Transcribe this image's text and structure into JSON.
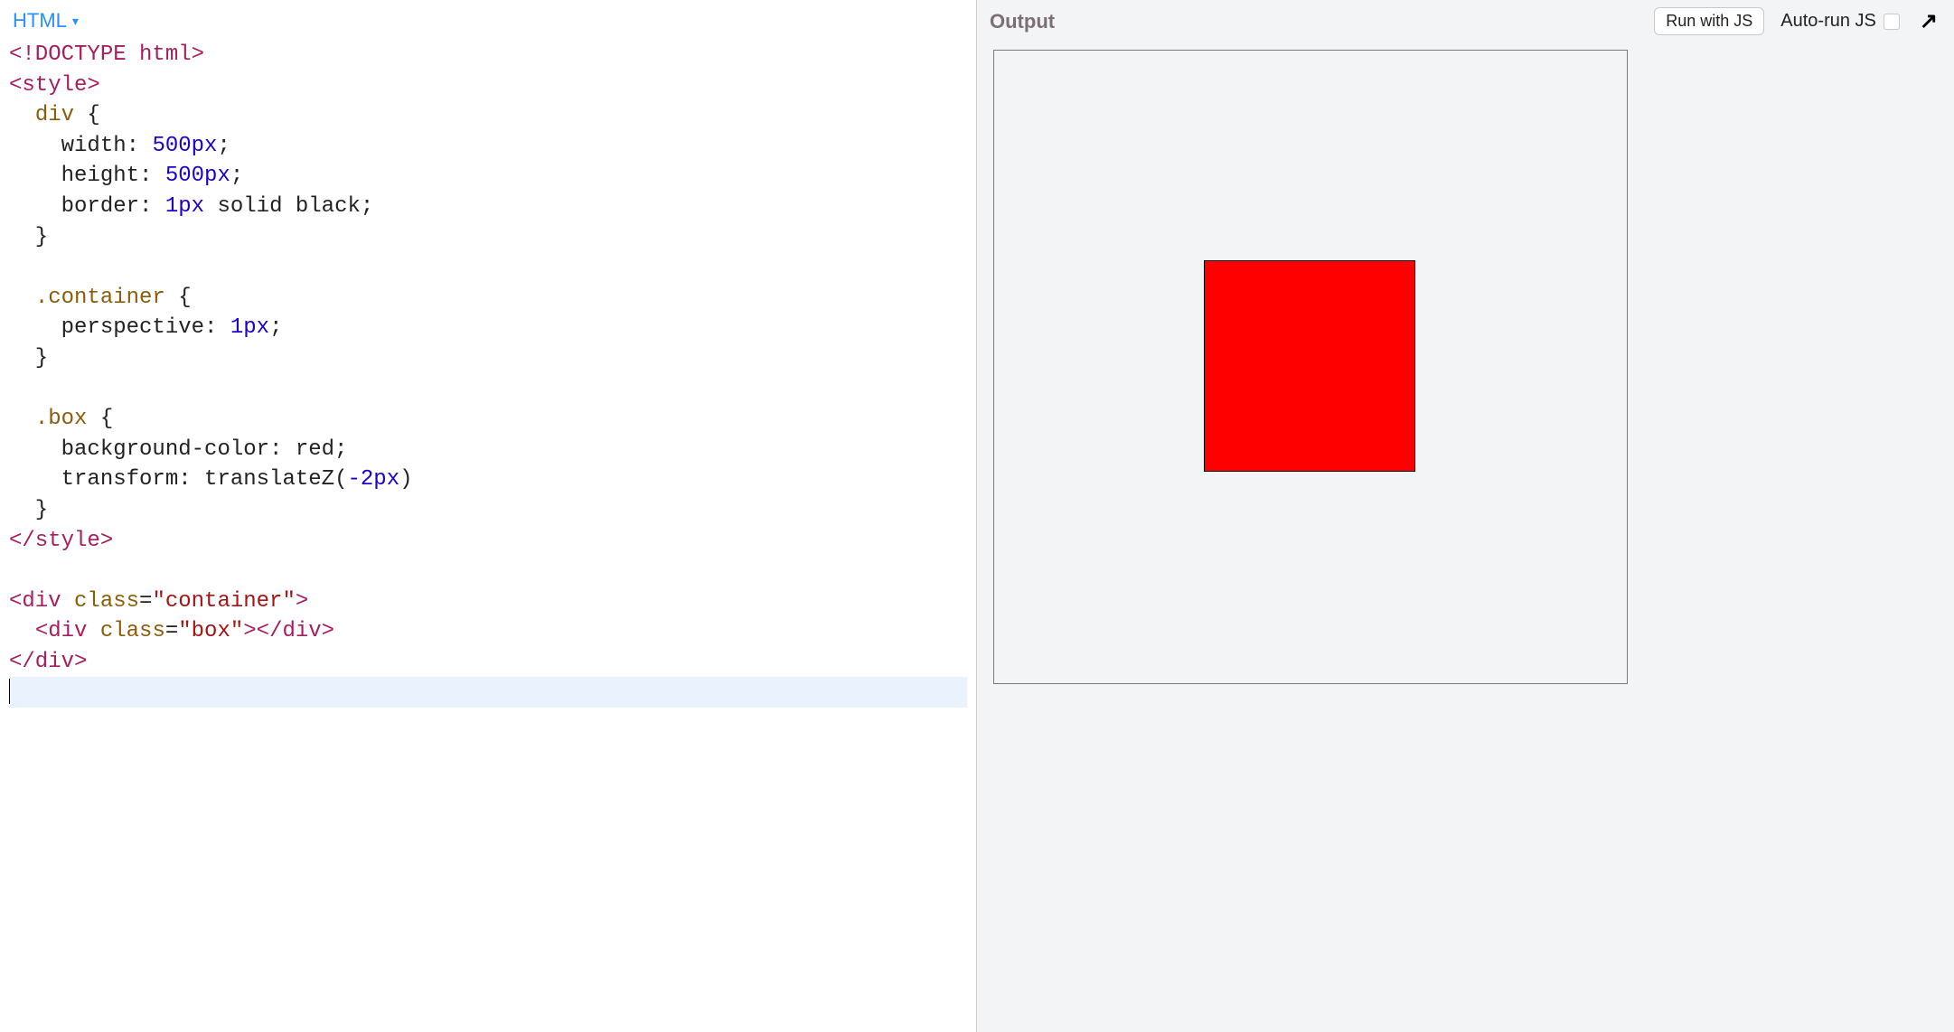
{
  "left": {
    "language_label": "HTML",
    "code_lines": [
      {
        "idx": 0,
        "segs": [
          {
            "c": "k",
            "t": "<!DOCTYPE html>"
          }
        ]
      },
      {
        "idx": 1,
        "segs": [
          {
            "c": "t",
            "t": "<style>"
          }
        ]
      },
      {
        "idx": 2,
        "segs": [
          {
            "c": "pun",
            "t": "  "
          },
          {
            "c": "sel",
            "t": "div"
          },
          {
            "c": "pun",
            "t": " {"
          }
        ]
      },
      {
        "idx": 3,
        "segs": [
          {
            "c": "pun",
            "t": "    "
          },
          {
            "c": "prop",
            "t": "width"
          },
          {
            "c": "pun",
            "t": ": "
          },
          {
            "c": "num",
            "t": "500px"
          },
          {
            "c": "pun",
            "t": ";"
          }
        ]
      },
      {
        "idx": 4,
        "segs": [
          {
            "c": "pun",
            "t": "    "
          },
          {
            "c": "prop",
            "t": "height"
          },
          {
            "c": "pun",
            "t": ": "
          },
          {
            "c": "num",
            "t": "500px"
          },
          {
            "c": "pun",
            "t": ";"
          }
        ]
      },
      {
        "idx": 5,
        "segs": [
          {
            "c": "pun",
            "t": "    "
          },
          {
            "c": "prop",
            "t": "border"
          },
          {
            "c": "pun",
            "t": ": "
          },
          {
            "c": "num",
            "t": "1px"
          },
          {
            "c": "pun",
            "t": " solid black;"
          }
        ]
      },
      {
        "idx": 6,
        "segs": [
          {
            "c": "pun",
            "t": "  }"
          }
        ]
      },
      {
        "idx": 7,
        "segs": [
          {
            "c": "pun",
            "t": ""
          }
        ]
      },
      {
        "idx": 8,
        "segs": [
          {
            "c": "pun",
            "t": "  "
          },
          {
            "c": "sel",
            "t": ".container"
          },
          {
            "c": "pun",
            "t": " {"
          }
        ]
      },
      {
        "idx": 9,
        "segs": [
          {
            "c": "pun",
            "t": "    "
          },
          {
            "c": "prop",
            "t": "perspective"
          },
          {
            "c": "pun",
            "t": ": "
          },
          {
            "c": "num",
            "t": "1px"
          },
          {
            "c": "pun",
            "t": ";"
          }
        ]
      },
      {
        "idx": 10,
        "segs": [
          {
            "c": "pun",
            "t": "  }"
          }
        ]
      },
      {
        "idx": 11,
        "segs": [
          {
            "c": "pun",
            "t": ""
          }
        ]
      },
      {
        "idx": 12,
        "segs": [
          {
            "c": "pun",
            "t": "  "
          },
          {
            "c": "sel",
            "t": ".box"
          },
          {
            "c": "pun",
            "t": " {"
          }
        ]
      },
      {
        "idx": 13,
        "segs": [
          {
            "c": "pun",
            "t": "    "
          },
          {
            "c": "prop",
            "t": "background-color"
          },
          {
            "c": "pun",
            "t": ": red;"
          }
        ]
      },
      {
        "idx": 14,
        "segs": [
          {
            "c": "pun",
            "t": "    "
          },
          {
            "c": "prop",
            "t": "transform"
          },
          {
            "c": "pun",
            "t": ": "
          },
          {
            "c": "fn",
            "t": "translateZ"
          },
          {
            "c": "pun",
            "t": "("
          },
          {
            "c": "num",
            "t": "-2px"
          },
          {
            "c": "pun",
            "t": ")"
          }
        ]
      },
      {
        "idx": 15,
        "segs": [
          {
            "c": "pun",
            "t": "  }"
          }
        ]
      },
      {
        "idx": 16,
        "segs": [
          {
            "c": "t",
            "t": "</style>"
          }
        ]
      },
      {
        "idx": 17,
        "segs": [
          {
            "c": "pun",
            "t": ""
          }
        ]
      },
      {
        "idx": 18,
        "segs": [
          {
            "c": "t",
            "t": "<div "
          },
          {
            "c": "at",
            "t": "class"
          },
          {
            "c": "pun",
            "t": "="
          },
          {
            "c": "av",
            "t": "\"container\""
          },
          {
            "c": "t",
            "t": ">"
          }
        ]
      },
      {
        "idx": 19,
        "segs": [
          {
            "c": "pun",
            "t": "  "
          },
          {
            "c": "t",
            "t": "<div "
          },
          {
            "c": "at",
            "t": "class"
          },
          {
            "c": "pun",
            "t": "="
          },
          {
            "c": "av",
            "t": "\"box\""
          },
          {
            "c": "t",
            "t": "></div>"
          }
        ]
      },
      {
        "idx": 20,
        "segs": [
          {
            "c": "t",
            "t": "</div>"
          }
        ]
      }
    ],
    "cursor_line_index": 21
  },
  "right": {
    "output_label": "Output",
    "run_button_label": "Run with JS",
    "autorun_label": "Auto-run JS",
    "autorun_checked": false,
    "popout_glyph": "↗"
  },
  "colors": {
    "accent_blue": "#2b90ff",
    "panel_bg": "#f3f4f5",
    "box_color": "#ff0000"
  }
}
